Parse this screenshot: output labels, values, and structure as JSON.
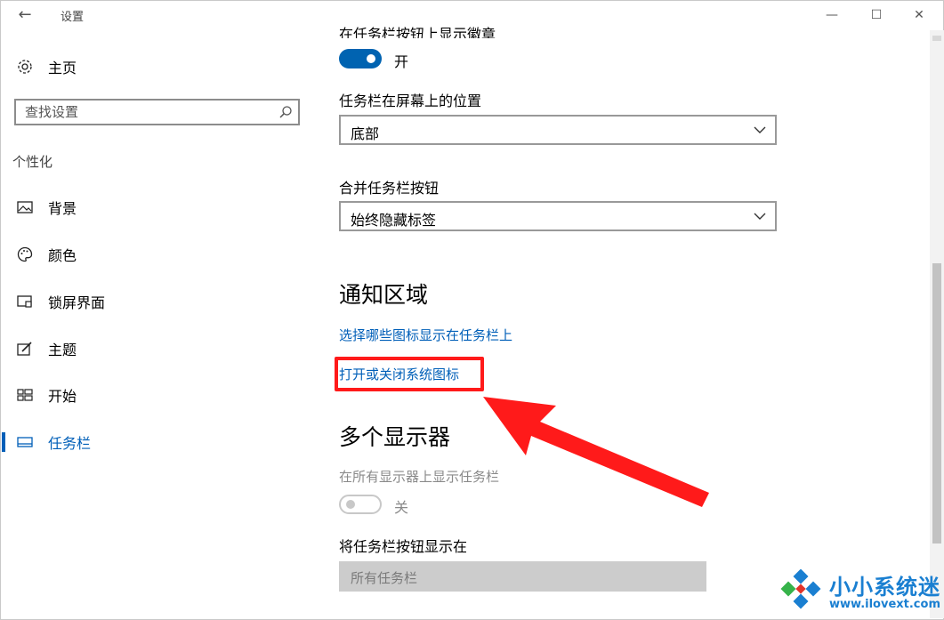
{
  "window": {
    "title": "设置",
    "back": "←",
    "minimize": "—",
    "maximize": "☐",
    "close": "✕"
  },
  "sidebar": {
    "home": "主页",
    "search_placeholder": "查找设置",
    "section": "个性化",
    "items": [
      {
        "label": "背景"
      },
      {
        "label": "颜色"
      },
      {
        "label": "锁屏界面"
      },
      {
        "label": "主题"
      },
      {
        "label": "开始"
      },
      {
        "label": "任务栏",
        "active": true
      }
    ]
  },
  "content": {
    "cut_heading": "在任务栏按钮上显示徽章",
    "badge_toggle": {
      "state": "on",
      "text": "开"
    },
    "position": {
      "label": "任务栏在屏幕上的位置",
      "value": "底部"
    },
    "combine": {
      "label": "合并任务栏按钮",
      "value": "始终隐藏标签"
    },
    "notify": {
      "title": "通知区域",
      "link1": "选择哪些图标显示在任务栏上",
      "link2": "打开或关闭系统图标"
    },
    "multi": {
      "title": "多个显示器",
      "show_label": "在所有显示器上显示任务栏",
      "toggle": {
        "state": "off",
        "text": "关"
      },
      "buttons_label": "将任务栏按钮显示在",
      "buttons_value": "所有任务栏"
    }
  },
  "watermark": {
    "text": "小小系统迷",
    "url": "www.ilovext.com"
  },
  "colors": {
    "accent": "#0063b1",
    "link": "#005fb8",
    "annotation": "#ff1a1a"
  }
}
